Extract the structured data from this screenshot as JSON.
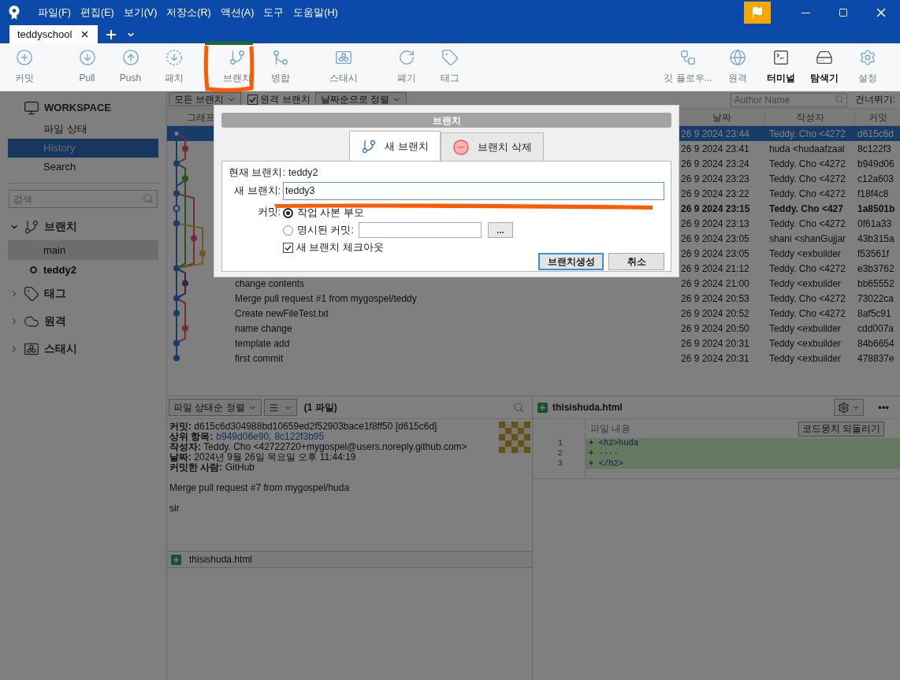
{
  "menu": [
    {
      "label": "파일(F)"
    },
    {
      "label": "편집(E)"
    },
    {
      "label": "보기(V)"
    },
    {
      "label": "저장소(R)"
    },
    {
      "label": "액션(A)"
    },
    {
      "label": "도구"
    },
    {
      "label": "도움말(H)"
    }
  ],
  "tab": {
    "label": "teddyschool",
    "selected": true
  },
  "toolbar": {
    "groups": [
      {
        "items": [
          {
            "label": "커밋",
            "kind": "commit",
            "highlighted": false
          }
        ]
      },
      {
        "items": [
          {
            "label": "Pull",
            "kind": "pull",
            "highlighted": false
          },
          {
            "label": "Push",
            "kind": "push",
            "highlighted": false
          },
          {
            "label": "패치",
            "kind": "fetch",
            "highlighted": false
          }
        ]
      },
      {
        "items": [
          {
            "label": "브랜치",
            "kind": "branch",
            "highlighted": false
          },
          {
            "label": "병합",
            "kind": "merge",
            "highlighted": false
          }
        ]
      },
      {
        "items": [
          {
            "label": "스태시",
            "kind": "stash",
            "highlighted": false
          }
        ]
      },
      {
        "items": [
          {
            "label": "폐기",
            "kind": "discard",
            "highlighted": false
          },
          {
            "label": "태그",
            "kind": "tag",
            "highlighted": false
          }
        ]
      }
    ],
    "right": [
      {
        "label": "깃 플로우...",
        "kind": "gitflow",
        "highlighted": false
      },
      {
        "label": "원격",
        "kind": "remote",
        "highlighted": false
      },
      {
        "label": "터미널",
        "kind": "terminal",
        "highlighted": true
      },
      {
        "label": "탐색기",
        "kind": "explorer",
        "highlighted": true
      },
      {
        "label": "설정",
        "kind": "settings",
        "highlighted": false
      }
    ]
  },
  "sidebar": {
    "workspace": "WORKSPACE",
    "views": [
      {
        "label": "파일 상태",
        "selected": false
      },
      {
        "label": "History",
        "selected": true
      },
      {
        "label": "Search",
        "selected": false
      }
    ],
    "search_placeholder": "검색",
    "sections": [
      {
        "label": "브랜치",
        "kind": "branch",
        "expanded": true,
        "children": [
          {
            "label": "main",
            "selected": true,
            "current": false
          },
          {
            "label": "teddy2",
            "selected": false,
            "current": true
          }
        ]
      },
      {
        "label": "태그",
        "kind": "tag",
        "expanded": false
      },
      {
        "label": "원격",
        "kind": "cloud",
        "expanded": false
      },
      {
        "label": "스태시",
        "kind": "stash",
        "expanded": false
      }
    ]
  },
  "history": {
    "filters": {
      "branches": "모든 브랜치",
      "remote": {
        "label": "원격 브랜치",
        "checked": true
      },
      "sort": "날짜순으로 정렬",
      "author_placeholder": "Author Name",
      "jump": "건너뛰기:"
    },
    "columns": [
      "그래프",
      "날짜",
      "작성자",
      "커밋"
    ],
    "rows": [
      {
        "date": "26 9 2024 23:44",
        "author": "Teddy. Cho <4272",
        "commit": "d615c6d",
        "selected": true,
        "bold": false
      },
      {
        "date": "26 9 2024 23:41",
        "author": "huda <hudaafzaal",
        "commit": "8c122f3",
        "selected": false,
        "bold": false
      },
      {
        "date": "26 9 2024 23:24",
        "author": "Teddy. Cho <4272",
        "commit": "b949d06",
        "selected": false,
        "bold": false
      },
      {
        "date": "26 9 2024 23:23",
        "author": "Teddy. Cho <4272",
        "commit": "c12a603",
        "selected": false,
        "bold": false
      },
      {
        "date": "26 9 2024 23:22",
        "author": "Teddy. Cho <4272",
        "commit": "f18f4c8",
        "selected": false,
        "bold": false
      },
      {
        "date": "26 9 2024 23:15",
        "author": "Teddy. Cho <427",
        "commit": "1a8501b",
        "selected": false,
        "bold": true
      },
      {
        "date": "26 9 2024 23:13",
        "author": "Teddy. Cho <4272",
        "commit": "0f61a33",
        "selected": false,
        "bold": false
      },
      {
        "date": "26 9 2024 23:05",
        "author": "shani <shanGujjar",
        "commit": "43b315a",
        "selected": false,
        "bold": false
      },
      {
        "date": "26 9 2024 23:05",
        "author": "Teddy <exbuilder",
        "commit": "f53561f",
        "selected": false,
        "bold": false
      },
      {
        "date": "26 9 2024 21:12",
        "author": "Teddy. Cho <4272",
        "commit": "e3b3762",
        "selected": false,
        "bold": false
      },
      {
        "message": "change contents",
        "date": "26 9 2024 21:00",
        "author": "Teddy <exbuilder",
        "commit": "bb65552",
        "selected": false,
        "bold": false
      },
      {
        "message": "Merge pull request #1 from mygospel/teddy",
        "date": "26 9 2024 20:53",
        "author": "Teddy. Cho <4272",
        "commit": "73022ca",
        "selected": false,
        "bold": false
      },
      {
        "message": "Create newFileTest.txt",
        "date": "26 9 2024 20:52",
        "author": "Teddy. Cho <4272",
        "commit": "8af5c91",
        "selected": false,
        "bold": false
      },
      {
        "message": "name change",
        "date": "26 9 2024 20:50",
        "author": "Teddy <exbuilder",
        "commit": "cdd007a",
        "selected": false,
        "bold": false
      },
      {
        "message": "template add",
        "date": "26 9 2024 20:31",
        "author": "Teddy <exbuilder",
        "commit": "84b6654",
        "selected": false,
        "bold": false
      },
      {
        "message": "first commit",
        "date": "26 9 2024 20:31",
        "author": "Teddy <exbuilder",
        "commit": "478837e",
        "selected": false,
        "bold": false
      }
    ]
  },
  "details": {
    "sort": "파일 상태순 정렬",
    "count": "(1 파일)",
    "lines": [
      "**커밋:** d615c6d304988bd10659ed2f52903bace1f8ff50 [d615c6d]",
      "**작성자:** Teddy. Cho <42722720+mygospel@users.noreply.github.com>",
      "**날짜:** 2024년 9월 26일 목요일 오후 11:44:19",
      "**커밋한 사람:** GitHub"
    ],
    "parents": {
      "label": "상위 항목:",
      "links": [
        "b949d06e90,",
        "8c122f3b95"
      ]
    },
    "message": [
      "Merge pull request #7 from mygospel/huda",
      "sir"
    ],
    "files": [
      {
        "name": "thisishuda.html"
      }
    ]
  },
  "diff": {
    "file": "thisishuda.html",
    "column": "파일 내용",
    "revert": "코드뭉치 되돌리기",
    "more": "•••",
    "lines": [
      {
        "num": "1",
        "sign": "+",
        "code": "<h2>huda"
      },
      {
        "num": "2",
        "sign": "+",
        "code": "····"
      },
      {
        "num": "3",
        "sign": "+",
        "code": "</h2>"
      }
    ]
  },
  "dialog": {
    "title": "브랜치",
    "tabs": [
      {
        "label": "새 브랜치",
        "kind": "branch",
        "selected": true
      },
      {
        "label": "브랜치 삭제",
        "kind": "remove",
        "selected": false
      }
    ],
    "current": {
      "label": "현재 브랜치:",
      "value": "teddy2"
    },
    "new_branch": {
      "label": "새 브랜치:",
      "value": "teddy3"
    },
    "commit": {
      "label": "커밋:",
      "options": [
        {
          "label": "작업 사본 부모",
          "selected": true
        },
        {
          "label": "명시된 커밋:",
          "selected": false
        }
      ],
      "browse": "..."
    },
    "checkout": {
      "label": "새 브랜치 체크아웃",
      "checked": true
    },
    "buttons": [
      {
        "label": "브랜치생성",
        "kind": "primary"
      },
      {
        "label": "취소",
        "kind": "secondary"
      }
    ]
  }
}
